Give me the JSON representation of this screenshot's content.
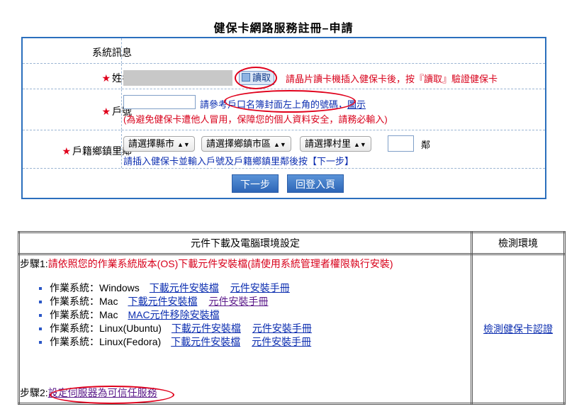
{
  "page": {
    "title": "健保卡網路服務註冊–申請"
  },
  "form": {
    "sys_label": "系統訊息",
    "star": "★",
    "name_label": "姓名",
    "read_button": "讀取",
    "read_hint": "請晶片讀卡機插入健保卡後，按『讀取』驗證健保卡",
    "household_label": "戶號",
    "household_hint": "請參考戶口名簿封面左上角的號碼，",
    "household_hint_link": "圖示",
    "household_warning": "(為避免健保卡遭他人冒用，保障您的個人資料安全，請務必輸入)",
    "neighborhood_label": "戶籍鄉鎮里鄰",
    "select_county": "請選擇縣市",
    "select_town": "請選擇鄉鎮市區",
    "select_village": "請選擇村里",
    "neighbor_suffix": "鄰",
    "neighborhood_hint": "請插入健保卡並輸入戶號及戶籍鄉鎮里鄰後按【下一步】",
    "next_button": "下一步",
    "back_button": "回登入頁"
  },
  "download": {
    "header_main": "元件下載及電腦環境設定",
    "header_side": "檢測環境",
    "step1_prefix": "步驟1:",
    "step1_text": "請依照您的作業系統版本(OS)下載元件安裝檔(請使用系統管理者權限執行安裝)",
    "os_items": [
      {
        "label": "作業系統：Windows",
        "link1": "下載元件安裝檔",
        "link2": "元件安裝手冊"
      },
      {
        "label": "作業系統：Mac",
        "link1": "下載元件安裝檔",
        "link2": "元件安裝手冊"
      },
      {
        "label": "作業系統：Mac",
        "link1": "MAC元件移除安裝檔",
        "link2": ""
      },
      {
        "label": "作業系統：Linux(Ubuntu)",
        "link1": "下載元件安裝檔",
        "link2": "元件安裝手冊"
      },
      {
        "label": "作業系統：Linux(Fedora)",
        "link1": "下載元件安裝檔",
        "link2": "元件安裝手冊"
      }
    ],
    "step2_prefix": "步驟2:",
    "step2_link": "設定伺服器為可信任服務",
    "check_link": "檢測健保卡認證"
  },
  "colors": {
    "accent_blue": "#2b6fbd",
    "warning_red": "#d8001a",
    "link_blue": "#0c2eb0"
  }
}
